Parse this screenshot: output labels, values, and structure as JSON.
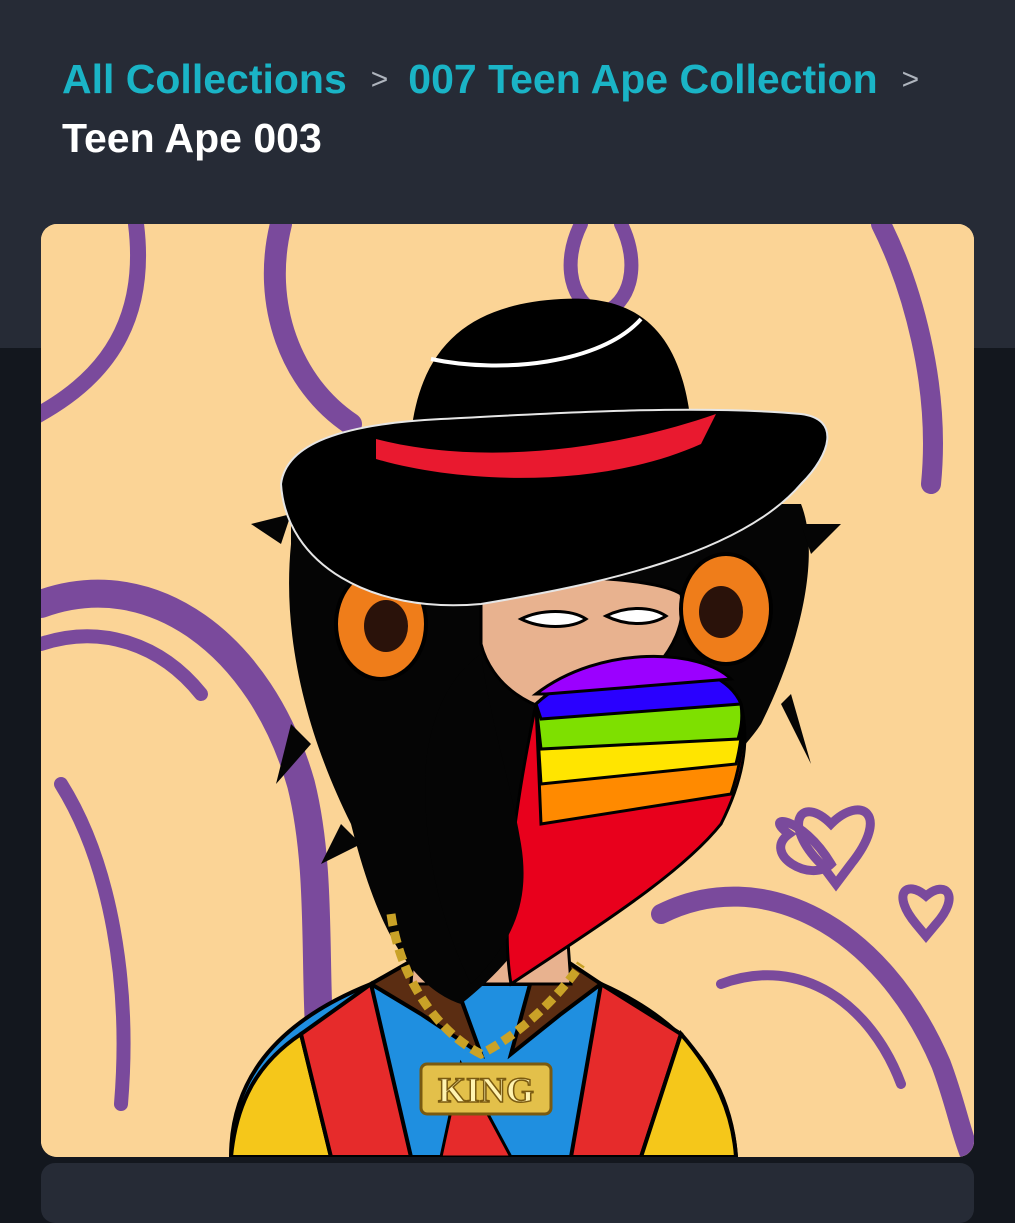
{
  "breadcrumb": {
    "all_collections": "All Collections",
    "separator": ">",
    "collection": "007 Teen Ape Collection",
    "current": "Teen Ape 003"
  },
  "nft": {
    "pendant_text": "KING"
  },
  "colors": {
    "header_bg": "#262b36",
    "page_bg": "#13171e",
    "link": "#1ab4c6",
    "card_bg": "#fbd496",
    "swirl": "#7a4a9c"
  }
}
